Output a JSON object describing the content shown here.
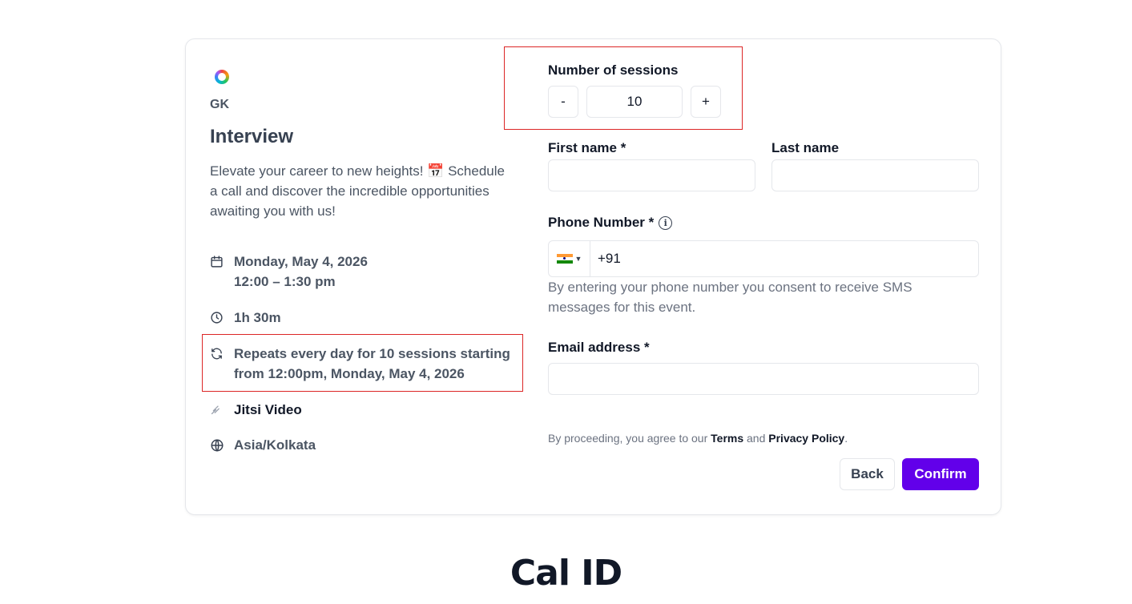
{
  "organizer": {
    "logo_icon": "multicolor-ring-logo",
    "name": "GK"
  },
  "event": {
    "title": "Interview",
    "description": "Elevate your career to new heights! 📅 Schedule a call and discover the incredible opportunities awaiting you with us!",
    "date": "Monday, May 4, 2026",
    "time": "12:00 – 1:30 pm",
    "duration": "1h 30m",
    "repeat": "Repeats every day for 10 sessions starting from 12:00pm, Monday, May 4, 2026",
    "location": "Jitsi Video",
    "timezone": "Asia/Kolkata"
  },
  "form": {
    "sessions": {
      "label": "Number of sessions",
      "decrement": "-",
      "increment": "+",
      "value": "10"
    },
    "first_name": {
      "label": "First name *",
      "value": ""
    },
    "last_name": {
      "label": "Last name",
      "value": ""
    },
    "phone": {
      "label": "Phone Number *",
      "info_icon": "i",
      "country_flag": "india-flag-icon",
      "value": "+91",
      "hint": "By entering your phone number you consent to receive SMS messages for this event."
    },
    "email": {
      "label": "Email address *",
      "value": ""
    },
    "legal": {
      "prefix": "By proceeding, you agree to our ",
      "terms": "Terms",
      "and": " and ",
      "privacy": "Privacy Policy",
      "suffix": "."
    },
    "back_label": "Back",
    "confirm_label": "Confirm"
  },
  "brand": {
    "name": "Cal ID"
  },
  "colors": {
    "accent": "#6200ea",
    "highlight": "#dc2626"
  }
}
